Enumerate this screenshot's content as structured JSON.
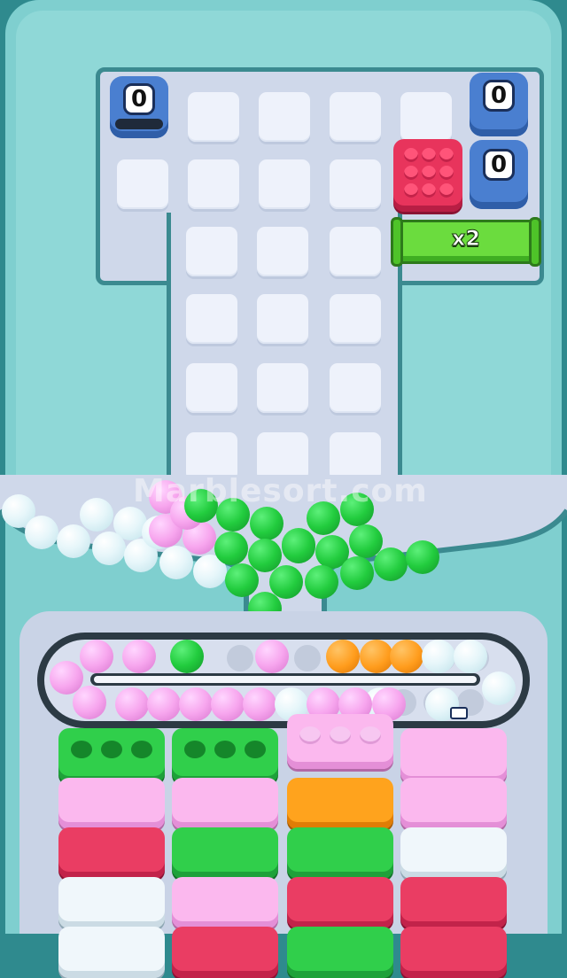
{
  "game": {
    "counters": {
      "left": "0",
      "right_top": "0",
      "right_bottom": "0"
    },
    "multiplier_label": "x2",
    "watermark": "Marblesort.com",
    "colors": {
      "frame": "#2f8a8e",
      "machine": "#7fcfcf",
      "board": "#cfd8ea",
      "cell": "#eef2fb",
      "counter_blue": "#4a7fd0",
      "red_box": "#e8345c",
      "multiplier_green": "#6bdc3e",
      "ball_white": "#e6f6fa",
      "ball_green": "#22cc3e",
      "ball_pink": "#f7a6ee",
      "ball_orange": "#ff9c1c"
    },
    "hopper_balls": {
      "white": 12,
      "pink": 4,
      "green": 20
    },
    "conveyor_balls": [
      "pink",
      "pink",
      "green",
      "pink",
      "orange",
      "orange",
      "orange",
      "white",
      "white",
      "white",
      "white",
      "pink",
      "pink",
      "pink",
      "pink",
      "pink",
      "pink",
      "pink",
      "white",
      "pink",
      "white",
      "pink",
      "pink"
    ],
    "box_columns": [
      [
        "green",
        "pink",
        "red",
        "white",
        "white"
      ],
      [
        "green",
        "pink",
        "green",
        "pink",
        "red"
      ],
      [
        "pink",
        "orange",
        "green",
        "red",
        "green"
      ],
      [
        "pink",
        "pink",
        "white",
        "red",
        "red"
      ]
    ]
  }
}
